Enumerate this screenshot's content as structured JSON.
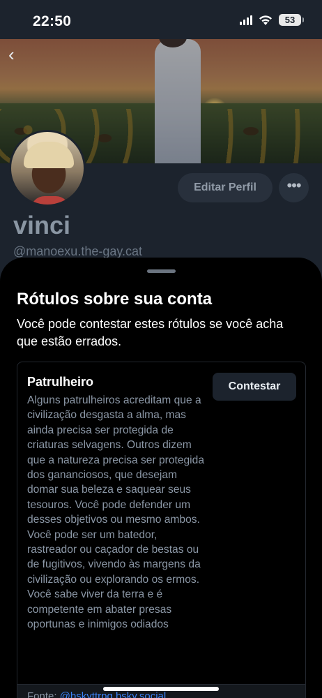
{
  "status_bar": {
    "time": "22:50",
    "battery": "53"
  },
  "profile": {
    "edit_button": "Editar Perfil",
    "more_button": "•••",
    "display_name": "vinci",
    "handle": "@manoexu.the-gay.cat"
  },
  "sheet": {
    "title": "Rótulos sobre sua conta",
    "description": "Você pode contestar estes rótulos se você acha que estão errados.",
    "label_card": {
      "label_name": "Patrulheiro",
      "contest_button": "Contestar",
      "description": "Alguns patrulheiros acreditam que a civilização desgasta a alma, mas ainda precisa ser protegida de criaturas selvagens. Outros dizem que a natureza precisa ser protegida dos gananciosos, que desejam domar sua beleza e saquear seus tesouros. Você pode defender um desses objetivos ou mesmo ambos. Você pode ser um batedor, rastreador ou caçador de bestas ou de fugitivos, vivendo às margens da civilização ou explorando os ermos. Você sabe viver da terra e é competente em abater presas oportunas e inimigos odiados",
      "source_prefix": "Fonte: ",
      "source_link": "@bskyttrpg.bsky.social"
    }
  },
  "icons": {
    "back": "chevron-left-icon",
    "signal": "cellular-signal-icon",
    "wifi": "wifi-icon",
    "battery": "battery-icon"
  },
  "colors": {
    "profile_background": "#1c232d",
    "sheet_background": "#000000",
    "muted_text": "#8b97a6",
    "link": "#3b82f6"
  }
}
